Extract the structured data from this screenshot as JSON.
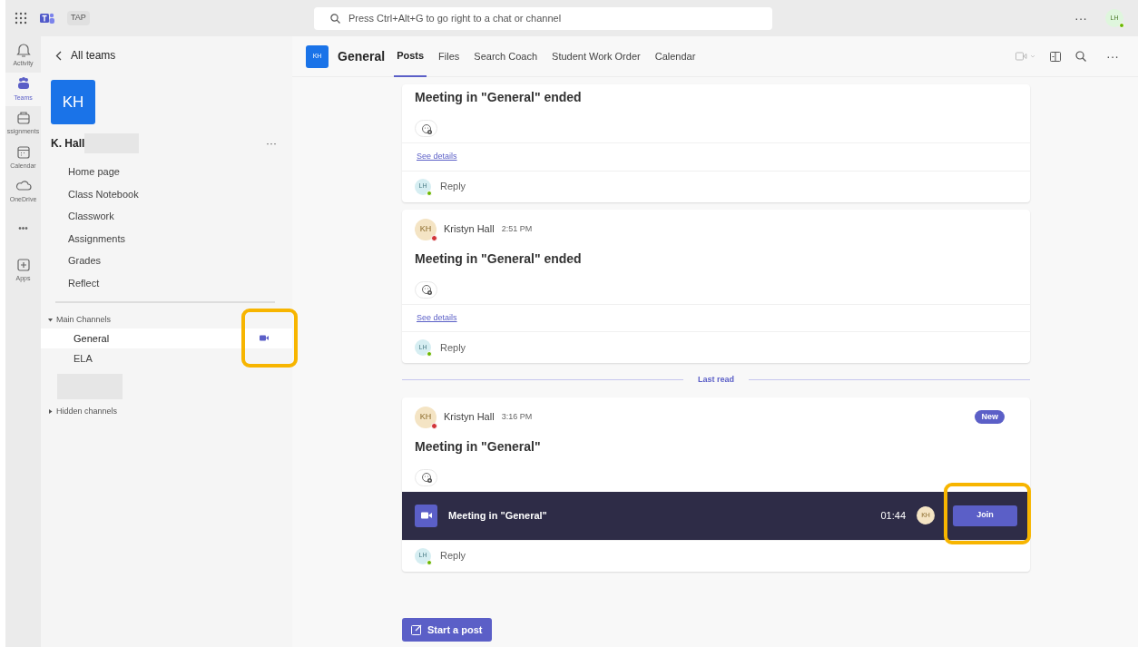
{
  "app_bar": {
    "org_label": "TAP",
    "search": {
      "placeholder": "Press Ctrl+Alt+G to go right to a chat or channel"
    },
    "more": "···",
    "user": {
      "initials": "LH"
    }
  },
  "rail": [
    {
      "kind": "activity",
      "label": "Activity",
      "selected": false
    },
    {
      "kind": "teams",
      "label": "Teams",
      "selected": true
    },
    {
      "kind": "assignments",
      "label": "ssignments",
      "selected": false
    },
    {
      "kind": "calendar",
      "label": "Calendar",
      "selected": false
    },
    {
      "kind": "onedrive",
      "label": "OneDrive",
      "selected": false
    },
    {
      "kind": "more",
      "label": "•••",
      "selected": false
    },
    {
      "kind": "apps",
      "label": "Apps",
      "selected": false
    }
  ],
  "team": {
    "back": "All teams",
    "avatar": "KH",
    "name": "K. Hall",
    "menu": "···",
    "links": [
      "Home page",
      "Class Notebook",
      "Classwork",
      "Assignments",
      "Grades",
      "Reflect"
    ],
    "sections": [
      {
        "label": "Main Channels",
        "expanded": true,
        "channels": [
          {
            "name": "General",
            "selected": true,
            "in_call": true,
            "highlighted": true
          },
          {
            "name": "ELA",
            "selected": false,
            "in_call": false,
            "highlighted": false
          }
        ]
      },
      {
        "label": "Hidden channels",
        "expanded": false
      }
    ]
  },
  "header": {
    "avatar": "KH",
    "title": "General",
    "tabs": [
      {
        "label": "Posts",
        "selected": true
      },
      {
        "label": "Files",
        "selected": false
      },
      {
        "label": "Search Coach",
        "selected": false
      },
      {
        "label": "Student Work Order",
        "selected": false
      },
      {
        "label": "Calendar",
        "selected": false
      }
    ],
    "more": "···"
  },
  "feed": [
    {
      "kind": "post",
      "title": "Meeting in \"General\" ended",
      "details": "See details",
      "reply": "Reply",
      "reply_avatar": "LH"
    },
    {
      "kind": "post",
      "author": "Kristyn Hall",
      "time": "2:51 PM",
      "avatar": "KH",
      "title": "Meeting in \"General\" ended",
      "details": "See details",
      "reply": "Reply",
      "reply_avatar": "LH"
    },
    {
      "kind": "divider",
      "label": "Last read"
    },
    {
      "kind": "post",
      "author": "Kristyn Hall",
      "time": "3:16 PM",
      "avatar": "KH",
      "badge": "New",
      "title": "Meeting in \"General\"",
      "meeting": {
        "title": "Meeting in \"General\"",
        "duration": "01:44",
        "participant": "KH",
        "join": "Join",
        "highlighted": true
      },
      "reply": "Reply",
      "reply_avatar": "LH"
    }
  ],
  "compose": {
    "label": "Start a post"
  }
}
